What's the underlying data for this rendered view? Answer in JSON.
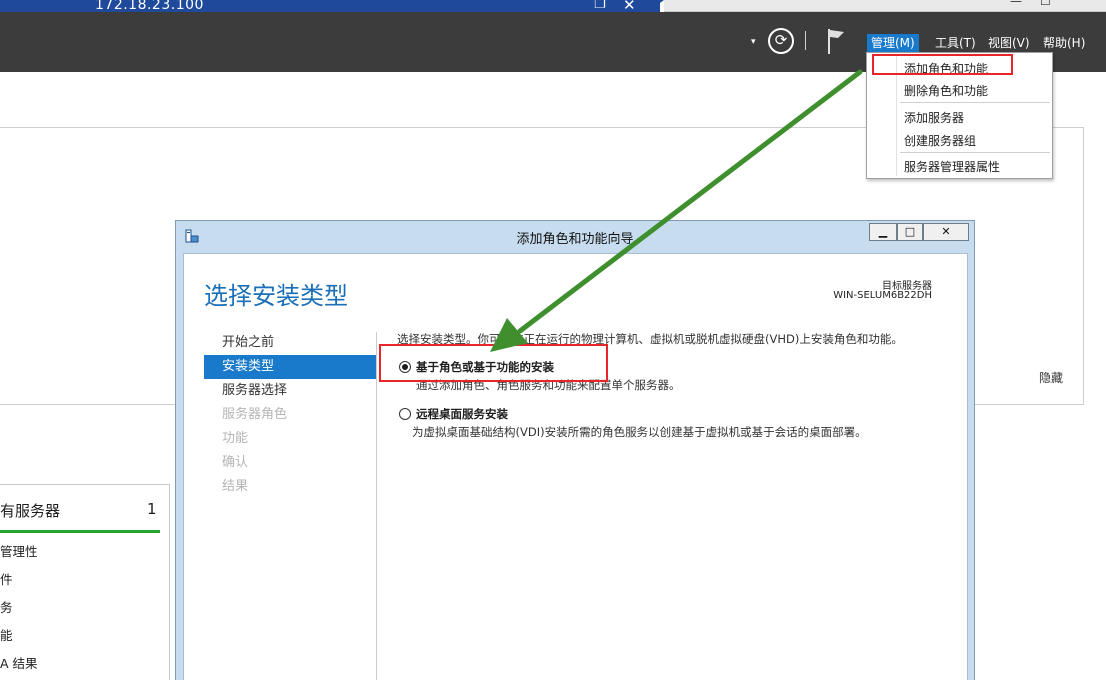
{
  "remote_session": {
    "address": "172.18.23.100",
    "minimize_glyph": "_",
    "restore_glyph": "❐",
    "close_glyph": "✕",
    "outer_window_controls": [
      "—",
      "☐"
    ]
  },
  "header": {
    "dropdown_arrow": "▾",
    "refresh_glyph": "⟳",
    "menus": [
      {
        "label": "管理(M)"
      },
      {
        "label": "工具(T)"
      },
      {
        "label": "视图(V)"
      },
      {
        "label": "帮助(H)"
      }
    ]
  },
  "manage_menu": {
    "items": [
      "添加角色和功能",
      "删除角色和功能",
      "添加服务器",
      "创建服务器组",
      "服务器管理器属性"
    ]
  },
  "welcome": {
    "hide_label": "隐藏"
  },
  "servers_tile": {
    "title": "有服务器",
    "count": "1",
    "items": [
      "管理性",
      "件",
      "务",
      "能",
      "A 结果"
    ]
  },
  "wizard": {
    "title": "添加角色和功能向导",
    "buttons": {
      "minimize": "▁",
      "maximize": "□",
      "close": "✕"
    },
    "heading": "选择安装类型",
    "target_label": "目标服务器",
    "target_name": "WIN-SELUM6B22DH",
    "nav": [
      {
        "label": "开始之前",
        "state": "normal"
      },
      {
        "label": "安装类型",
        "state": "selected"
      },
      {
        "label": "服务器选择",
        "state": "normal"
      },
      {
        "label": "服务器角色",
        "state": "disabled"
      },
      {
        "label": "功能",
        "state": "disabled"
      },
      {
        "label": "确认",
        "state": "disabled"
      },
      {
        "label": "结果",
        "state": "disabled"
      }
    ],
    "intro": "选择安装类型。你可以在正在运行的物理计算机、虚拟机或脱机虚拟硬盘(VHD)上安装角色和功能。",
    "options": [
      {
        "title": "基于角色或基于功能的安装",
        "desc": "通过添加角色、角色服务和功能来配置单个服务器。",
        "selected": true
      },
      {
        "title": "远程桌面服务安装",
        "desc": "为虚拟桌面基础结构(VDI)安装所需的角色服务以创建基于虚拟机或基于会话的桌面部署。",
        "selected": false
      }
    ]
  },
  "colors": {
    "accent": "#1979ca",
    "annotation_box": "#e8262a",
    "annotation_arrow": "#3f8f2e",
    "tile_bar": "#22a52a"
  }
}
